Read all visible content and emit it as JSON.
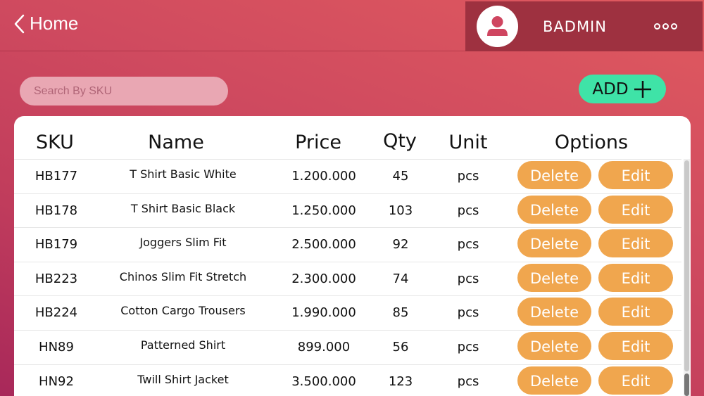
{
  "header": {
    "back_label": "Home",
    "username": "BADMIN"
  },
  "search": {
    "placeholder": "Search By SKU"
  },
  "add_button": {
    "label": "ADD"
  },
  "table": {
    "columns": [
      "SKU",
      "Name",
      "Price",
      "Qty",
      "Unit",
      "Options"
    ],
    "rows": [
      {
        "sku": "HB177",
        "name": "T Shirt Basic White",
        "price": "1.200.000",
        "qty": "45",
        "unit": "pcs"
      },
      {
        "sku": "HB178",
        "name": "T Shirt Basic Black",
        "price": "1.250.000",
        "qty": "103",
        "unit": "pcs"
      },
      {
        "sku": "HB179",
        "name": "Joggers Slim Fit",
        "price": "2.500.000",
        "qty": "92",
        "unit": "pcs"
      },
      {
        "sku": "HB223",
        "name": "Chinos Slim Fit Stretch",
        "price": "2.300.000",
        "qty": "74",
        "unit": "pcs"
      },
      {
        "sku": "HB224",
        "name": "Cotton Cargo Trousers",
        "price": "1.990.000",
        "qty": "85",
        "unit": "pcs"
      },
      {
        "sku": "HN89",
        "name": "Patterned Shirt",
        "price": "899.000",
        "qty": "56",
        "unit": "pcs"
      },
      {
        "sku": "HN92",
        "name": "Twill Shirt Jacket",
        "price": "3.500.000",
        "qty": "123",
        "unit": "pcs"
      }
    ],
    "delete_label": "Delete",
    "edit_label": "Edit"
  },
  "colors": {
    "accent_add": "#3fe3a7",
    "action_button": "#f0a64e",
    "user_panel": "#9e3140"
  }
}
